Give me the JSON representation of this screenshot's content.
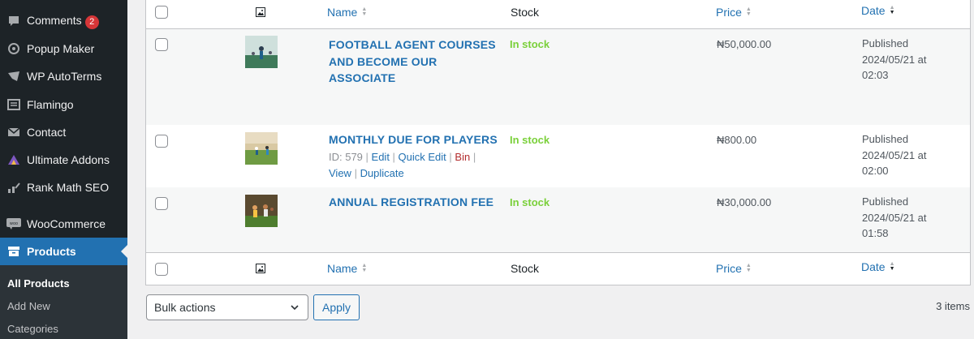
{
  "sidebar": {
    "items": [
      {
        "label": "Comments",
        "icon": "comment-icon",
        "badge": "2"
      },
      {
        "label": "Popup Maker",
        "icon": "popup-maker-icon"
      },
      {
        "label": "WP AutoTerms",
        "icon": "shield-icon"
      },
      {
        "label": "Flamingo",
        "icon": "inbox-icon"
      },
      {
        "label": "Contact",
        "icon": "envelope-icon"
      },
      {
        "label": "Ultimate Addons",
        "icon": "addons-icon"
      },
      {
        "label": "Rank Math SEO",
        "icon": "chart-icon"
      },
      {
        "label": "WooCommerce",
        "icon": "woo-icon"
      },
      {
        "label": "Products",
        "icon": "archive-icon",
        "active": true
      }
    ],
    "submenu": [
      {
        "label": "All Products",
        "current": true
      },
      {
        "label": "Add New"
      },
      {
        "label": "Categories"
      }
    ]
  },
  "table": {
    "columns": {
      "name": "Name",
      "stock": "Stock",
      "price": "Price",
      "date": "Date"
    },
    "rows": [
      {
        "name": "FOOTBALL AGENT COURSES AND BECOME OUR ASSOCIATE",
        "stock": "In stock",
        "price": "₦50,000.00",
        "date_status": "Published",
        "date_day": "2024/05/21 at",
        "date_time": "02:03"
      },
      {
        "name": "MONTHLY DUE FOR PLAYERS",
        "stock": "In stock",
        "price": "₦800.00",
        "date_status": "Published",
        "date_day": "2024/05/21 at",
        "date_time": "02:00",
        "actions": {
          "id": "ID: 579",
          "edit": "Edit",
          "quick_edit": "Quick Edit",
          "bin": "Bin",
          "view": "View",
          "duplicate": "Duplicate"
        }
      },
      {
        "name": "ANNUAL REGISTRATION FEE",
        "stock": "In stock",
        "price": "₦30,000.00",
        "date_status": "Published",
        "date_day": "2024/05/21 at",
        "date_time": "01:58"
      }
    ]
  },
  "footer": {
    "bulk_actions": "Bulk actions",
    "apply": "Apply",
    "items_count": "3 items"
  },
  "colors": {
    "accent": "#2271b1",
    "in_stock": "#7ad03a",
    "sidebar_bg": "#1d2327",
    "badge": "#d63638",
    "bin": "#b32d2e"
  }
}
